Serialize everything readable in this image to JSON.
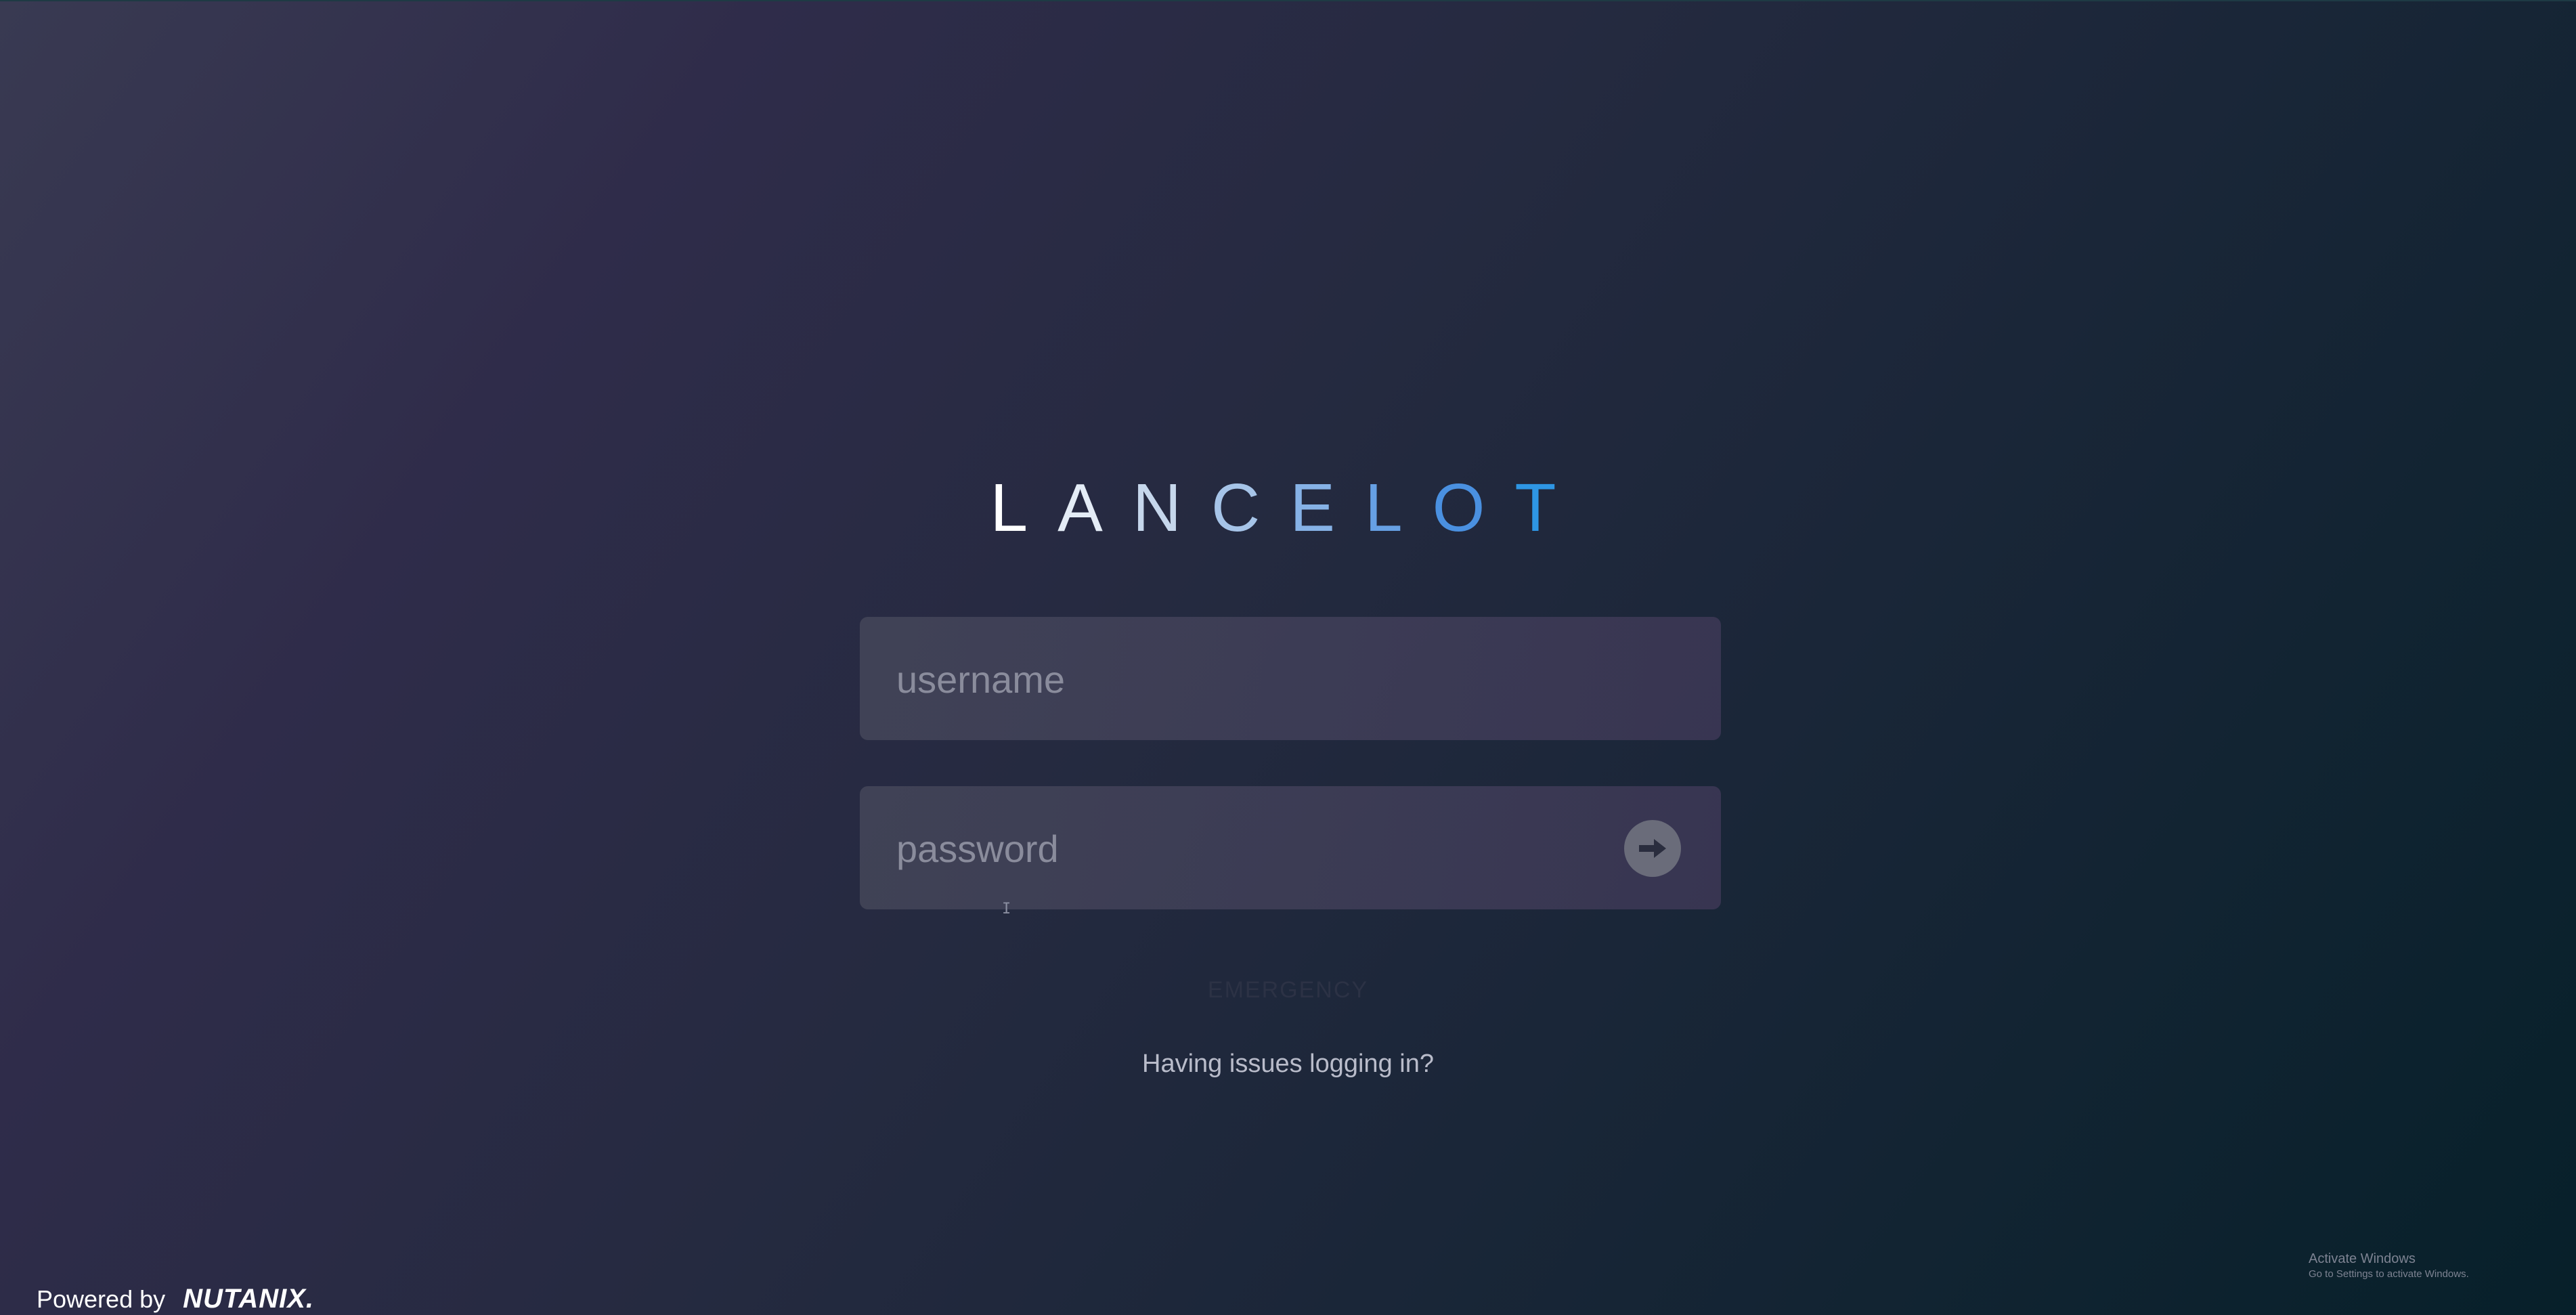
{
  "logo": {
    "letters": [
      {
        "char": "L",
        "color": "#ffffff"
      },
      {
        "char": "A",
        "color": "#e4ecf6"
      },
      {
        "char": "N",
        "color": "#c6d7ec"
      },
      {
        "char": "C",
        "color": "#a6c4e8"
      },
      {
        "char": "E",
        "color": "#86b2e6"
      },
      {
        "char": "L",
        "color": "#66a0e4"
      },
      {
        "char": "O",
        "color": "#4a90e0"
      },
      {
        "char": "T",
        "color": "#2e96e4"
      }
    ]
  },
  "username": {
    "placeholder": "username",
    "value": ""
  },
  "password": {
    "placeholder": "password",
    "value": "",
    "submit_icon": "arrow-right-icon"
  },
  "cursor_glyph": "I",
  "faint_text": "EMERGENCY",
  "issues_link": "Having issues logging in?",
  "activate_windows": {
    "title": "Activate Windows",
    "subtitle": "Go to Settings to activate Windows."
  },
  "footer": {
    "powered_by": "Powered by",
    "brand": "NUTANIX."
  }
}
